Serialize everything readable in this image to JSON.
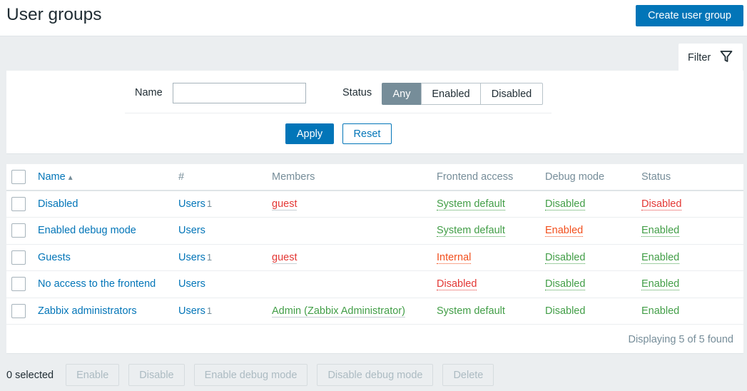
{
  "header": {
    "title": "User groups",
    "create_button": "Create user group"
  },
  "filter": {
    "tab_label": "Filter",
    "tab_icon": "funnel-icon",
    "name_label": "Name",
    "name_value": "",
    "name_placeholder": "",
    "status_label": "Status",
    "status_options": [
      "Any",
      "Enabled",
      "Disabled"
    ],
    "status_selected": "Any",
    "apply_label": "Apply",
    "reset_label": "Reset"
  },
  "table": {
    "columns": [
      "Name",
      "#",
      "Members",
      "Frontend access",
      "Debug mode",
      "Status"
    ],
    "sort_column": "Name",
    "sort_direction": "ascending",
    "rows": [
      {
        "name": "Disabled",
        "users_label": "Users",
        "users_count": "1",
        "members": "guest",
        "frontend_access": "System default",
        "debug_mode": "Disabled",
        "status": "Disabled"
      },
      {
        "name": "Enabled debug mode",
        "users_label": "Users",
        "users_count": "",
        "members": "",
        "frontend_access": "System default",
        "debug_mode": "Enabled",
        "status": "Enabled"
      },
      {
        "name": "Guests",
        "users_label": "Users",
        "users_count": "1",
        "members": "guest",
        "frontend_access": "Internal",
        "debug_mode": "Disabled",
        "status": "Enabled"
      },
      {
        "name": "No access to the frontend",
        "users_label": "Users",
        "users_count": "",
        "members": "",
        "frontend_access": "Disabled",
        "debug_mode": "Disabled",
        "status": "Enabled"
      },
      {
        "name": "Zabbix administrators",
        "users_label": "Users",
        "users_count": "1",
        "members": "Admin (Zabbix Administrator)",
        "frontend_access": "System default",
        "debug_mode": "Disabled",
        "status": "Enabled"
      }
    ],
    "paging_text": "Displaying 5 of 5 found"
  },
  "footer": {
    "selected_text": "0 selected",
    "actions": [
      "Enable",
      "Disable",
      "Enable debug mode",
      "Disable debug mode",
      "Delete"
    ]
  },
  "colors": {
    "primary": "#0275b8",
    "green": "#429e47",
    "red": "#e33734",
    "orange": "#f24f1d",
    "muted": "#768d99",
    "background": "#ebeef0"
  }
}
